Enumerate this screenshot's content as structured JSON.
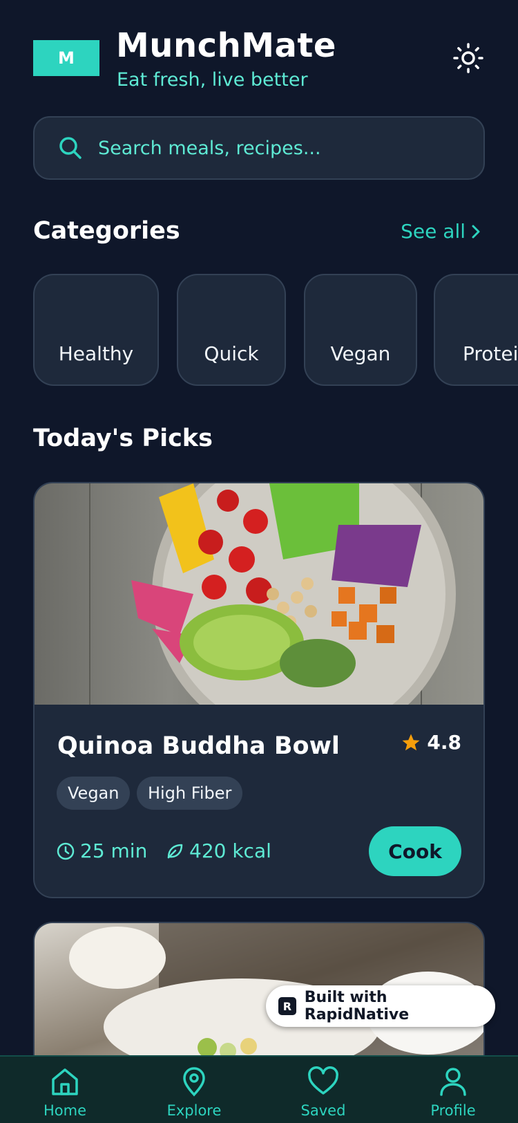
{
  "header": {
    "logo_letter": "M",
    "app_name": "MunchMate",
    "tagline": "Eat fresh, live better"
  },
  "search": {
    "placeholder": "Search meals, recipes..."
  },
  "categories": {
    "title": "Categories",
    "see_all": "See all",
    "items": [
      {
        "label": "Healthy"
      },
      {
        "label": "Quick"
      },
      {
        "label": "Vegan"
      },
      {
        "label": "Protein"
      }
    ]
  },
  "picks": {
    "title": "Today's Picks",
    "cards": [
      {
        "name": "Quinoa Buddha Bowl",
        "rating": "4.8",
        "tags": [
          "Vegan",
          "High Fiber"
        ],
        "time": "25 min",
        "calories": "420 kcal",
        "cta": "Cook"
      }
    ]
  },
  "badge": {
    "text": "Built with RapidNative"
  },
  "tabbar": {
    "items": [
      {
        "label": "Home",
        "icon": "home-icon"
      },
      {
        "label": "Explore",
        "icon": "map-pin-icon"
      },
      {
        "label": "Saved",
        "icon": "heart-icon"
      },
      {
        "label": "Profile",
        "icon": "user-icon"
      }
    ]
  },
  "colors": {
    "background": "#0f172a",
    "surface": "#1e293b",
    "accent": "#2dd4bf",
    "accent_text": "#5eead4",
    "star": "#f59e0b"
  }
}
